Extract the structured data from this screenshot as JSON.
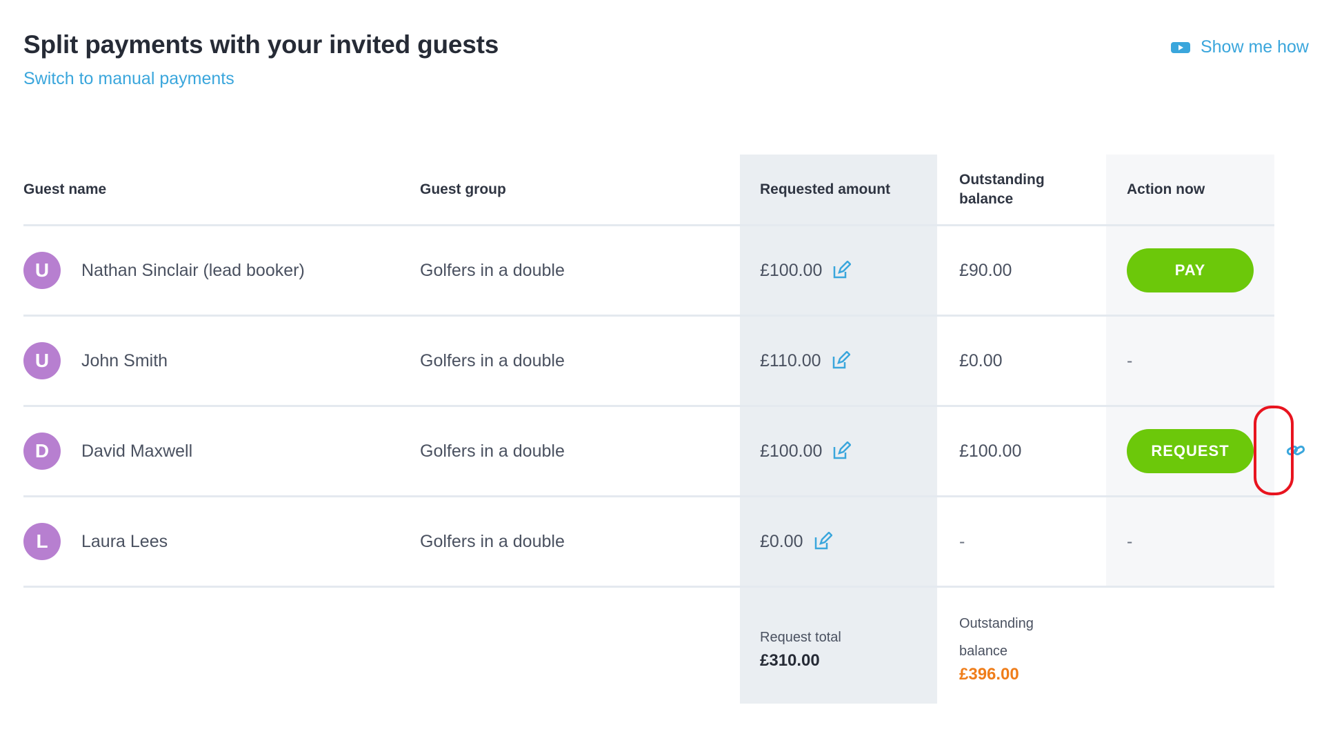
{
  "header": {
    "title": "Split payments with your invited guests",
    "switch_link": "Switch to manual payments",
    "show_me_how": "Show me how"
  },
  "table": {
    "columns": {
      "guest_name": "Guest name",
      "guest_group": "Guest group",
      "requested_amount": "Requested amount",
      "outstanding_line1": "Outstanding",
      "outstanding_line2": "balance",
      "action_now": "Action now"
    },
    "rows": [
      {
        "initial": "U",
        "name": "Nathan Sinclair (lead booker)",
        "group": "Golfers in a double",
        "requested": "£100.00",
        "outstanding": "£90.00",
        "action": "PAY"
      },
      {
        "initial": "U",
        "name": "John Smith",
        "group": "Golfers in a double",
        "requested": "£110.00",
        "outstanding": "£0.00",
        "action": "-"
      },
      {
        "initial": "D",
        "name": "David Maxwell",
        "group": "Golfers in a double",
        "requested": "£100.00",
        "outstanding": "£100.00",
        "action": "REQUEST"
      },
      {
        "initial": "L",
        "name": "Laura Lees",
        "group": "Golfers in a double",
        "requested": "£0.00",
        "outstanding": "-",
        "action": "-"
      }
    ]
  },
  "totals": {
    "request_label": "Request total",
    "request_value": "£310.00",
    "outstanding_label_line1": "Outstanding",
    "outstanding_label_line2": "balance",
    "outstanding_value": "£396.00"
  },
  "icons": {
    "video": "video-icon",
    "edit": "edit-icon",
    "link": "link-icon"
  },
  "colors": {
    "accent_blue": "#3aa6dc",
    "button_green": "#6cc80a",
    "avatar_purple": "#b77fd0",
    "outstanding_orange": "#ef7d1a",
    "highlight_red": "#e8141f"
  }
}
